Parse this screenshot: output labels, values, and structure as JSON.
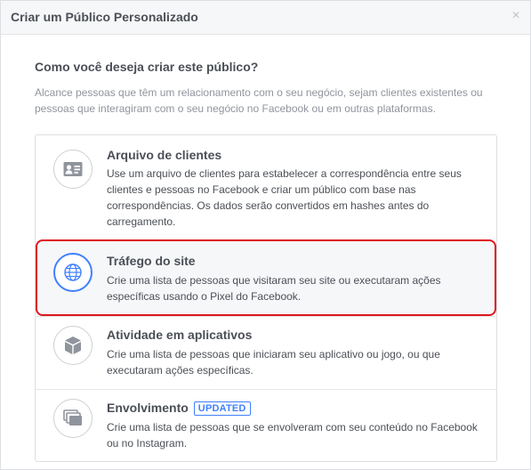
{
  "dialog": {
    "title": "Criar um Público Personalizado",
    "close_symbol": "×"
  },
  "question": "Como você deseja criar este público?",
  "subtitle": "Alcance pessoas que têm um relacionamento com o seu negócio, sejam clientes existentes ou pessoas que interagiram com o seu negócio no Facebook ou em outras plataformas.",
  "options": [
    {
      "title": "Arquivo de clientes",
      "description": "Use um arquivo de clientes para estabelecer a correspondência entre seus clientes e pessoas no Facebook e criar um público com base nas correspondências. Os dados serão convertidos em hashes antes do carregamento.",
      "icon": "contact-card-icon"
    },
    {
      "title": "Tráfego do site",
      "description": "Crie uma lista de pessoas que visitaram seu site ou executaram ações específicas usando o Pixel do Facebook.",
      "icon": "globe-icon",
      "selected": true
    },
    {
      "title": "Atividade em aplicativos",
      "description": "Crie uma lista de pessoas que iniciaram seu aplicativo ou jogo, ou que executaram ações específicas.",
      "icon": "cube-icon"
    },
    {
      "title": "Envolvimento",
      "badge": "UPDATED",
      "description": "Crie uma lista de pessoas que se envolveram com seu conteúdo no Facebook ou no Instagram.",
      "icon": "media-stack-icon"
    }
  ],
  "colors": {
    "accent": "#4080ff",
    "highlight_border": "#e0161d",
    "text": "#4b4f56",
    "muted": "#90949c"
  }
}
